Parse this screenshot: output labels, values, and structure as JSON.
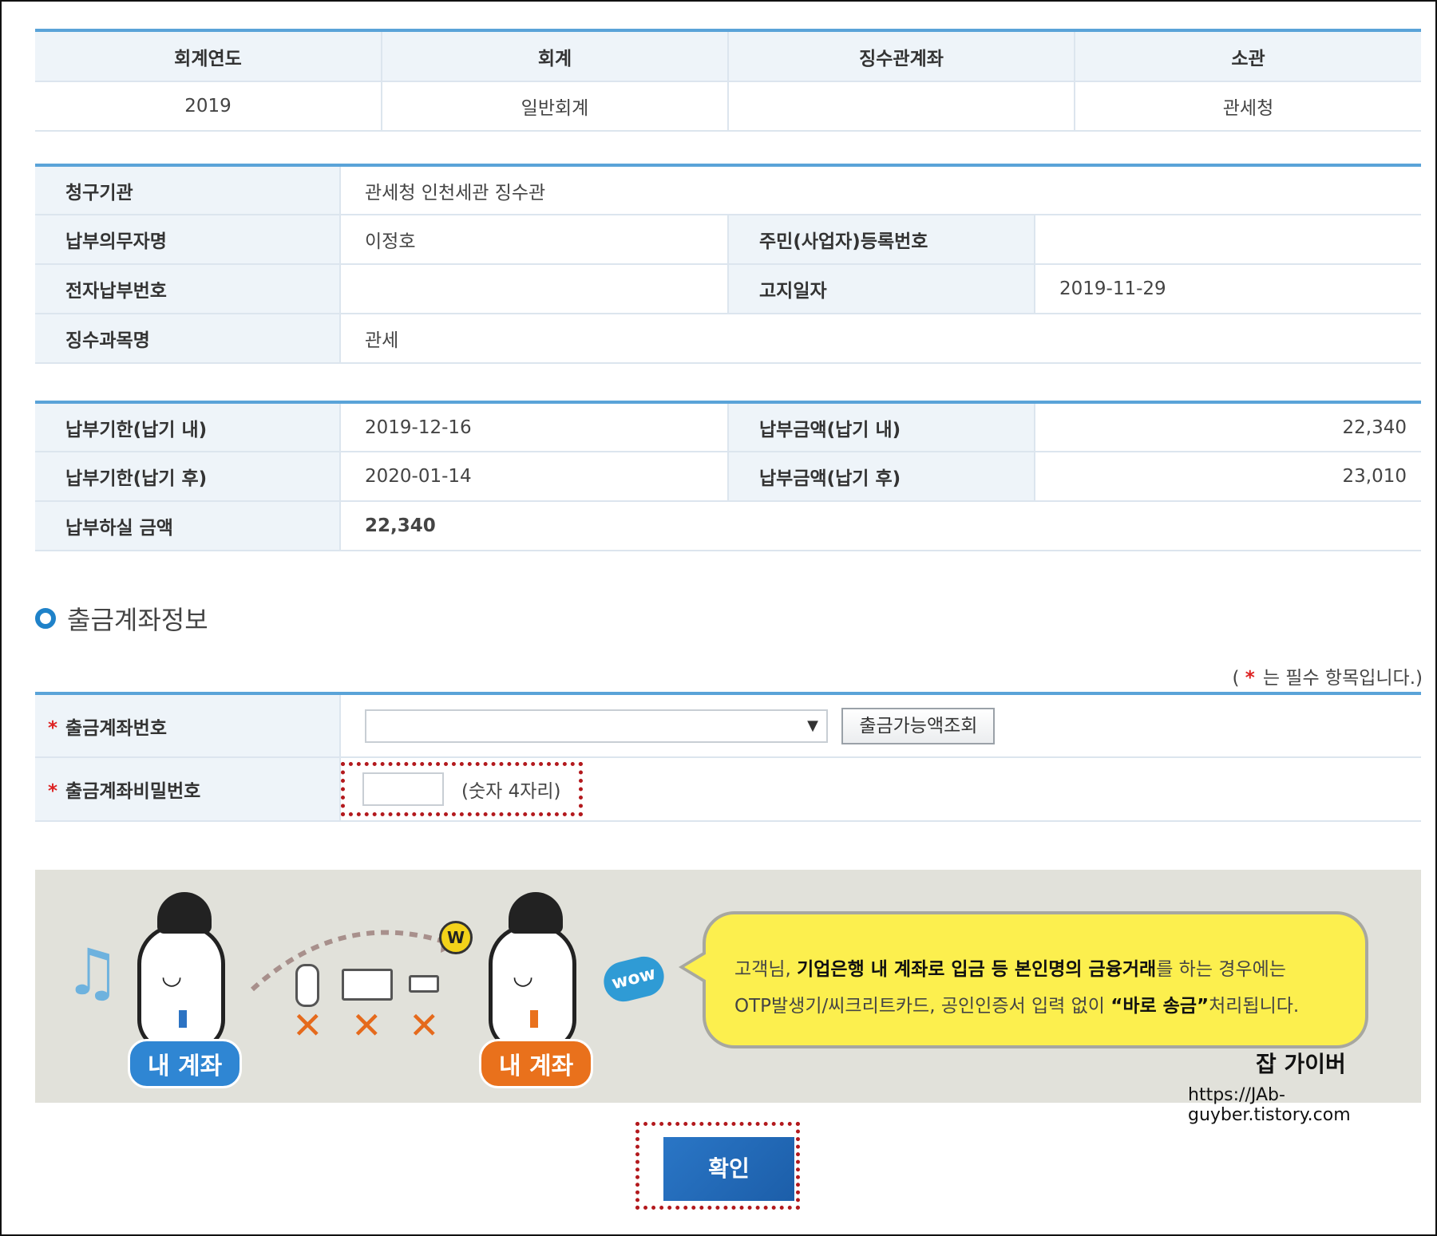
{
  "summary_table": {
    "headers": [
      "회계연도",
      "회계",
      "징수관계좌",
      "소관"
    ],
    "row": [
      "2019",
      "일반회계",
      "",
      "관세청"
    ]
  },
  "bill_info": {
    "claim_org_label": "청구기관",
    "claim_org_value": "관세청 인천세관 징수관",
    "payer_label": "납부의무자명",
    "payer_value": "이정호",
    "reg_no_label": "주민(사업자)등록번호",
    "reg_no_value": "",
    "epay_no_label": "전자납부번호",
    "epay_no_value": "",
    "notice_date_label": "고지일자",
    "notice_date_value": "2019-11-29",
    "subject_label": "징수과목명",
    "subject_value": "관세"
  },
  "payment_info": {
    "due_in_label": "납부기한(납기 내)",
    "due_in_value": "2019-12-16",
    "amount_in_label": "납부금액(납기 내)",
    "amount_in_value": "22,340",
    "due_after_label": "납부기한(납기 후)",
    "due_after_value": "2020-01-14",
    "amount_after_label": "납부금액(납기 후)",
    "amount_after_value": "23,010",
    "pay_amount_label": "납부하실 금액",
    "pay_amount_value": "22,340"
  },
  "account_section": {
    "title": "출금계좌정보",
    "required_note_open": "(",
    "required_note_star": "*",
    "required_note_text": "는 필수 항목입니다.)",
    "account_no_label": "출금계좌번호",
    "account_no_selected": "",
    "balance_button": "출금가능액조회",
    "password_label": "출금계좌비밀번호",
    "password_hint": "(숫자 4자리)"
  },
  "banner": {
    "left_pill": "내 계좌",
    "right_pill": "내 계좌",
    "coin_letter": "W",
    "wow_text": "wow",
    "msg_prefix": "고객님, ",
    "msg_bold1": "기업은행 내 계좌로 입금 등 본인명의 금융거래",
    "msg_mid": "를 하는 경우에는",
    "msg_line2_prefix": "OTP발생기/씨크리트카드, 공인인증서 입력 없이 ",
    "msg_bold2": "“바로 송금”",
    "msg_suffix": "처리됩니다."
  },
  "watermark": {
    "name": "잡 가이버",
    "url": "https://JAb-guyber.tistory.com"
  },
  "confirm_button": "확인",
  "colors": {
    "accent": "#5aa3d8",
    "header_bg": "#eef4f9",
    "highlight_border": "#b3191d",
    "button_blue": "#2a76c6"
  }
}
